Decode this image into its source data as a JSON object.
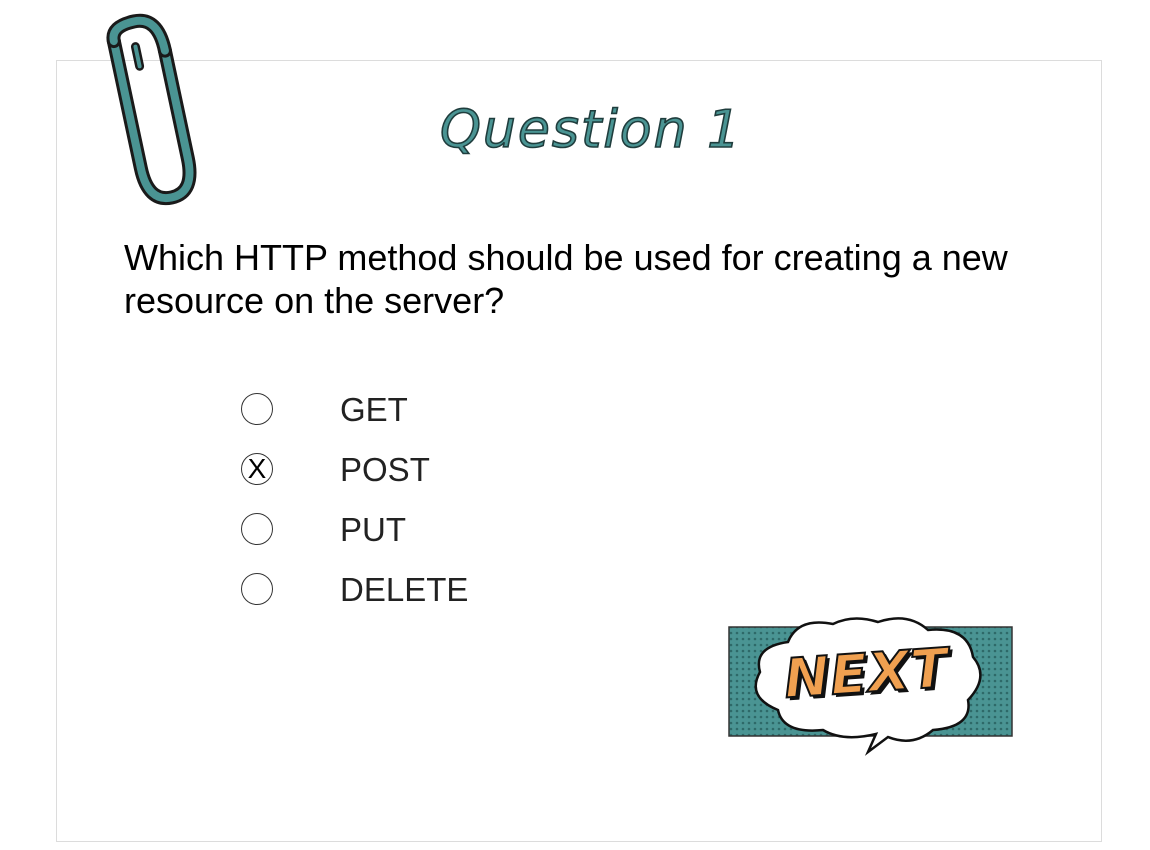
{
  "quiz": {
    "title": "Question 1",
    "question": "Which HTTP method should be used for creating a new resource on the server?",
    "options": [
      {
        "label": "GET",
        "selected": false,
        "mark": ""
      },
      {
        "label": "POST",
        "selected": true,
        "mark": "X"
      },
      {
        "label": "PUT",
        "selected": false,
        "mark": ""
      },
      {
        "label": "DELETE",
        "selected": false,
        "mark": ""
      }
    ],
    "next_label": "NEXT"
  },
  "colors": {
    "accent_teal": "#4a9493",
    "next_text": "#f0a050"
  },
  "icons": {
    "decoration": "paperclip-icon",
    "next_bubble": "speech-bubble-icon"
  }
}
